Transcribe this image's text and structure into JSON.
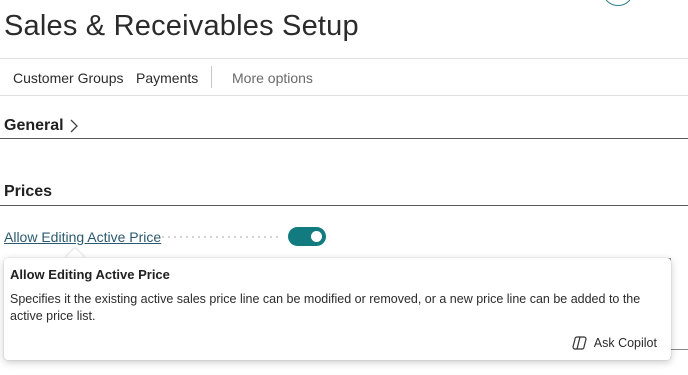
{
  "page": {
    "title": "Sales & Receivables Setup"
  },
  "actions": {
    "items": [
      {
        "label": "Customer Groups"
      },
      {
        "label": "Payments"
      }
    ],
    "more_label": "More options"
  },
  "sections": {
    "general": {
      "title": "General"
    },
    "prices": {
      "title": "Prices"
    }
  },
  "fields": {
    "allow_editing_active_price": {
      "label": "Allow Editing Active Price",
      "value": true
    }
  },
  "tooltip": {
    "title": "Allow Editing Active Price",
    "body": "Specifies it the existing active sales price line can be modified or removed, or a new price line can be added to the active price list.",
    "copilot_label": "Ask Copilot"
  },
  "colors": {
    "accent": "#117b80",
    "link": "#2b5a70"
  }
}
